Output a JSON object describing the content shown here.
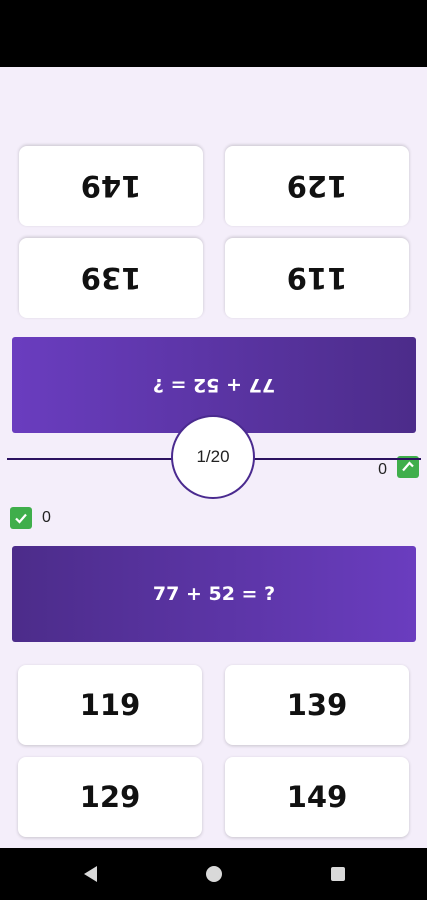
{
  "question": "77 + 52  =  ?",
  "progress": "1/20",
  "player_top": {
    "score": "0",
    "answers": [
      "149",
      "129",
      "139",
      "119"
    ]
  },
  "player_bottom": {
    "score": "0",
    "answers": [
      "119",
      "139",
      "129",
      "149"
    ]
  },
  "colors": {
    "background": "#f4eefa",
    "question_gradient_start": "#4c2c8a",
    "question_gradient_end": "#6a3dbf",
    "check_green": "#3fae4b",
    "divider": "#2b1260"
  },
  "icons": {
    "score": "check-icon",
    "nav": [
      "back-icon",
      "home-icon",
      "recents-icon"
    ]
  }
}
